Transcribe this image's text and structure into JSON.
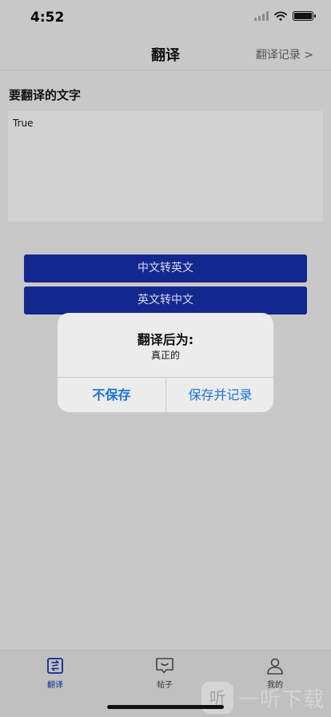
{
  "status": {
    "time": "4:52"
  },
  "nav": {
    "title": "翻译",
    "history_link": "翻译记录 >"
  },
  "form": {
    "label": "要翻译的文字",
    "input_value": "True"
  },
  "buttons": {
    "zh_to_en": "中文转英文",
    "en_to_zh": "英文转中文"
  },
  "alert": {
    "title": "翻译后为:",
    "message": "真正的",
    "cancel_label": "不保存",
    "confirm_label": "保存并记录"
  },
  "tabs": [
    {
      "label": "翻译",
      "icon": "translate-icon",
      "active": true
    },
    {
      "label": "帖子",
      "icon": "chat-icon",
      "active": false
    },
    {
      "label": "我的",
      "icon": "person-icon",
      "active": false
    }
  ],
  "watermark": {
    "badge": "听",
    "text": "一听下载"
  },
  "colors": {
    "accent": "#13288e",
    "link": "#1a73e0",
    "background": "#c8c8c8"
  }
}
